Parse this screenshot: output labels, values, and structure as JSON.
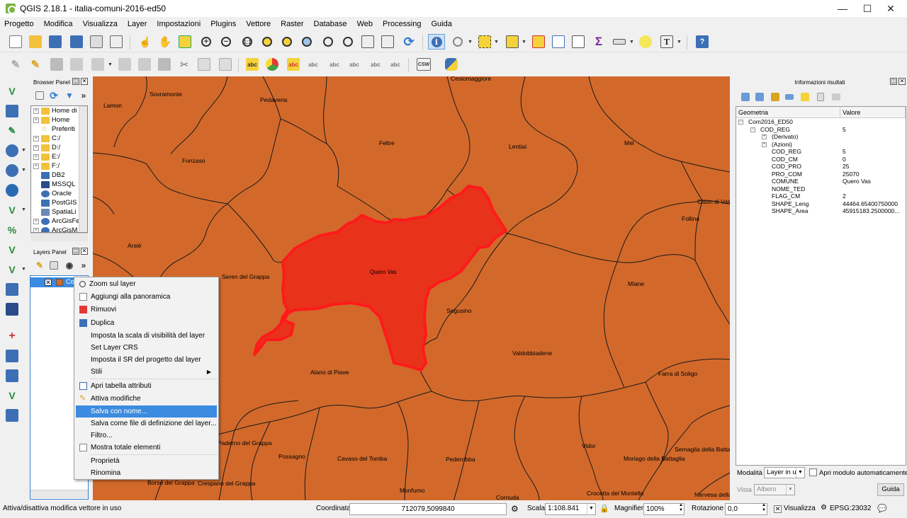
{
  "window": {
    "title": "QGIS 2.18.1 - italia-comuni-2016-ed50",
    "minimize": "—",
    "maximize": "☐",
    "close": "✕"
  },
  "menu": [
    "Progetto",
    "Modifica",
    "Visualizza",
    "Layer",
    "Impostazioni",
    "Plugins",
    "Vettore",
    "Raster",
    "Database",
    "Web",
    "Processing",
    "Guida"
  ],
  "toolbar2": {
    "csw_label": "CSW",
    "abc_label": "abc"
  },
  "browser": {
    "title": "Browser Panel",
    "items": [
      "Home di",
      "Home",
      "Preferiti",
      "C:/",
      "D:/",
      "E:/",
      "F:/",
      "DB2",
      "MSSQL",
      "Oracle",
      "PostGIS",
      "SpatiaLi",
      "ArcGisFe",
      "ArcGisM"
    ]
  },
  "layers": {
    "title": "Layers Panel",
    "layer_name": "Co"
  },
  "map": {
    "labels": [
      "Cesiomaggiore",
      "Sovramonte",
      "Lamon",
      "Pedavena",
      "Feltre",
      "Lentiai",
      "Mel",
      "Fonzaso",
      "Cison di Valmarino",
      "Follina",
      "Arsiè",
      "Seren del Grappa",
      "Quero Vas",
      "Segusino",
      "Miane",
      "Valdobbiadene",
      "Alano di Piave",
      "Farra di Soligo",
      "Paderno del Grappa",
      "Possagno",
      "Cavaso del Tomba",
      "Pederobba",
      "Vidor",
      "Moriago della Battaglia",
      "Sernaglia della Battaglia",
      "Borso del Grappa",
      "Crespano del Grappa",
      "Monfumo",
      "Cornuda",
      "Crocetta del Montello",
      "Nervesa della Battaglia"
    ]
  },
  "context_menu": {
    "items": [
      "Zoom sul layer",
      "Aggiungi alla panoramica",
      "Rimuovi",
      "Duplica",
      "Imposta la scala di visibilità del layer",
      "Set Layer CRS",
      "Imposta il SR del progetto dal layer",
      "Stili",
      "Apri tabella attributi",
      "Attiva modifiche",
      "Salva con nome...",
      "Salva come file di definizione del layer...",
      "Filtro...",
      "Mostra totale elementi",
      "Proprietà",
      "Rinomina"
    ],
    "highlighted": "Salva con nome..."
  },
  "results": {
    "title": "Informazioni risultati",
    "col_geometry": "Geometria",
    "col_value": "Valore",
    "layer": "Com2016_ED50",
    "feature": {
      "key": "COD_REG",
      "value": "5"
    },
    "derived": "(Derivato)",
    "actions": "(Azioni)",
    "attributes": [
      {
        "key": "COD_REG",
        "value": "5"
      },
      {
        "key": "COD_CM",
        "value": "0"
      },
      {
        "key": "COD_PRO",
        "value": "25"
      },
      {
        "key": "PRO_COM",
        "value": "25070"
      },
      {
        "key": "COMUNE",
        "value": "Quero Vas"
      },
      {
        "key": "NOME_TED",
        "value": ""
      },
      {
        "key": "FLAG_CM",
        "value": "2"
      },
      {
        "key": "SHAPE_Leng",
        "value": "44464.65400750000"
      },
      {
        "key": "SHAPE_Area",
        "value": "45915183.2500000..."
      }
    ],
    "mode_label": "Modalità",
    "mode_value": "Layer in u",
    "auto_open_label": "Apri modulo automaticamente",
    "view_label": "Vista",
    "view_value": "Albero",
    "help_button": "Guida"
  },
  "status": {
    "message": "Attiva/disattiva modifica vettore in uso",
    "coord_label": "Coordinata",
    "coord_value": "712079,5099840",
    "scale_label": "Scala",
    "scale_value": "1:108.841",
    "magnifier_label": "Magnifier",
    "magnifier_value": "100%",
    "rotation_label": "Rotazione",
    "rotation_value": "0,0",
    "render_label": "Visualizza",
    "crs_label": "EPSG:23032"
  },
  "colors": {
    "map_fill": "#d2692b",
    "selected_fill": "#e8321a",
    "selected_stroke": "#ff1a1a",
    "menu_highlight": "#3b8be0"
  }
}
